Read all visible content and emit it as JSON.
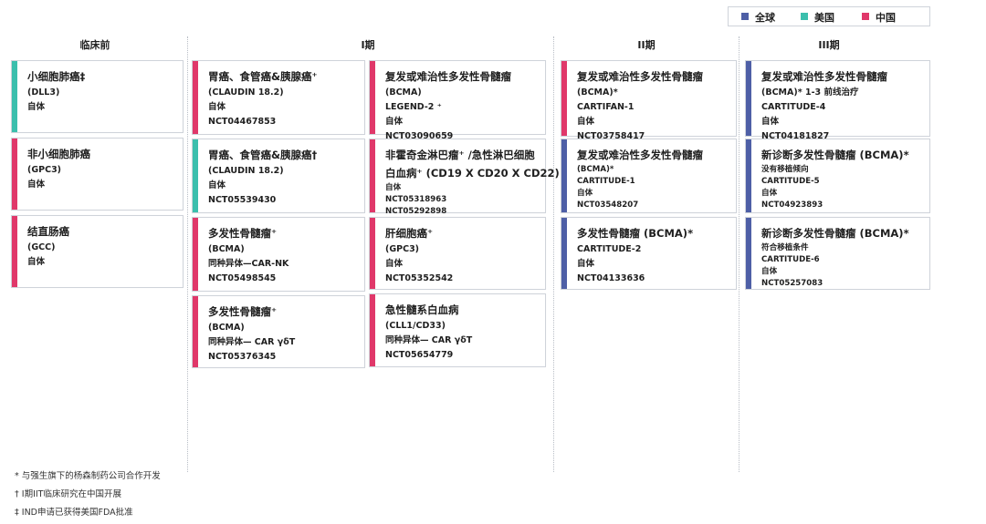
{
  "legend": [
    {
      "label": "全球",
      "color": "#4e5fa6"
    },
    {
      "label": "美国",
      "color": "#3bbfad"
    },
    {
      "label": "中国",
      "color": "#e0386a"
    }
  ],
  "phases": [
    "临床前",
    "I期",
    "II期",
    "III期"
  ],
  "cards": [
    {
      "id": "sclc",
      "color": "#3bbfad",
      "lines": [
        {
          "t": "小细胞肺癌‡",
          "k": "t"
        },
        {
          "t": "(DLL3)"
        },
        {
          "t": "自体"
        }
      ]
    },
    {
      "id": "nsclc",
      "color": "#e0386a",
      "lines": [
        {
          "t": "非小细胞肺癌",
          "k": "t"
        },
        {
          "t": "(GPC3)"
        },
        {
          "t": "自体"
        }
      ]
    },
    {
      "id": "crc",
      "color": "#e0386a",
      "lines": [
        {
          "t": "结直肠癌",
          "k": "t"
        },
        {
          "t": "(GCC)"
        },
        {
          "t": "自体"
        }
      ]
    },
    {
      "id": "gc1",
      "color": "#e0386a",
      "lines": [
        {
          "t": "胃癌、食管癌&胰腺癌⁺",
          "k": "t"
        },
        {
          "t": "(CLAUDIN 18.2)"
        },
        {
          "t": "自体"
        },
        {
          "t": "NCT04467853"
        }
      ]
    },
    {
      "id": "gc2",
      "color": "#3bbfad",
      "lines": [
        {
          "t": "胃癌、食管癌&胰腺癌†",
          "k": "t"
        },
        {
          "t": "(CLAUDIN 18.2)"
        },
        {
          "t": "自体"
        },
        {
          "t": "NCT05539430"
        }
      ]
    },
    {
      "id": "mm1",
      "color": "#e0386a",
      "lines": [
        {
          "t": "多发性骨髓瘤⁺",
          "k": "t"
        },
        {
          "t": "(BCMA)"
        },
        {
          "t": "同种异体—CAR-NK"
        },
        {
          "t": "NCT05498545"
        }
      ]
    },
    {
      "id": "mm2",
      "color": "#e0386a",
      "lines": [
        {
          "t": "多发性骨髓瘤⁺",
          "k": "t"
        },
        {
          "t": "(BCMA)"
        },
        {
          "t": "同种异体— CAR γδT"
        },
        {
          "t": "NCT05376345"
        }
      ]
    },
    {
      "id": "rrmm1",
      "color": "#e0386a",
      "lines": [
        {
          "t": "复发或难治性多发性骨髓瘤",
          "k": "t"
        },
        {
          "t": "(BCMA)"
        },
        {
          "t": "LEGEND-2 ⁺"
        },
        {
          "t": "自体"
        },
        {
          "t": "NCT03090659"
        }
      ]
    },
    {
      "id": "nhl",
      "color": "#e0386a",
      "lines": [
        {
          "t": "非霍奇金淋巴瘤⁺ /急性淋巴细胞",
          "k": "t"
        },
        {
          "t": "白血病⁺ (CD19 X CD20 X CD22) ⁺",
          "k": "t"
        },
        {
          "t": "自体",
          "k": "s"
        },
        {
          "t": "NCT05318963",
          "k": "s"
        },
        {
          "t": "NCT05292898",
          "k": "s"
        }
      ]
    },
    {
      "id": "hcc",
      "color": "#e0386a",
      "lines": [
        {
          "t": "肝细胞癌⁺",
          "k": "t"
        },
        {
          "t": "(GPC3)"
        },
        {
          "t": "自体"
        },
        {
          "t": "NCT05352542"
        }
      ]
    },
    {
      "id": "aml",
      "color": "#e0386a",
      "lines": [
        {
          "t": "急性髓系白血病",
          "k": "t"
        },
        {
          "t": "(CLL1/CD33)"
        },
        {
          "t": "同种异体— CAR γδT"
        },
        {
          "t": "NCT05654779"
        }
      ]
    },
    {
      "id": "p2a",
      "color": "#e0386a",
      "lines": [
        {
          "t": "复发或难治性多发性骨髓瘤",
          "k": "t"
        },
        {
          "t": "(BCMA)*"
        },
        {
          "t": "CARTIFAN-1"
        },
        {
          "t": "自体"
        },
        {
          "t": "NCT03758417"
        }
      ]
    },
    {
      "id": "p2b",
      "color": "#4e5fa6",
      "lines": [
        {
          "t": "复发或难治性多发性骨髓瘤",
          "k": "t"
        },
        {
          "t": "(BCMA)*",
          "k": "s"
        },
        {
          "t": "CARTITUDE-1",
          "k": "s"
        },
        {
          "t": "自体",
          "k": "s"
        },
        {
          "t": "NCT03548207",
          "k": "s"
        }
      ]
    },
    {
      "id": "p2c",
      "color": "#4e5fa6",
      "lines": [
        {
          "t": "多发性骨髓瘤 (BCMA)*",
          "k": "t"
        },
        {
          "t": "CARTITUDE-2"
        },
        {
          "t": "自体"
        },
        {
          "t": "NCT04133636"
        }
      ]
    },
    {
      "id": "p3a",
      "color": "#4e5fa6",
      "lines": [
        {
          "t": "复发或难治性多发性骨髓瘤",
          "k": "t"
        },
        {
          "t": "(BCMA)*   1-3 前线治疗"
        },
        {
          "t": "CARTITUDE-4"
        },
        {
          "t": "自体"
        },
        {
          "t": "NCT04181827"
        }
      ]
    },
    {
      "id": "p3b",
      "color": "#4e5fa6",
      "lines": [
        {
          "t": "新诊断多发性骨髓瘤 (BCMA)*",
          "k": "t"
        },
        {
          "t": "没有移植倾向",
          "k": "s"
        },
        {
          "t": "CARTITUDE-5",
          "k": "s"
        },
        {
          "t": "自体",
          "k": "s"
        },
        {
          "t": "NCT04923893",
          "k": "s"
        }
      ]
    },
    {
      "id": "p3c",
      "color": "#4e5fa6",
      "lines": [
        {
          "t": "新诊断多发性骨髓瘤 (BCMA)*",
          "k": "t"
        },
        {
          "t": "符合移植条件",
          "k": "s"
        },
        {
          "t": "CARTITUDE-6",
          "k": "s"
        },
        {
          "t": "自体",
          "k": "s"
        },
        {
          "t": "NCT05257083",
          "k": "s"
        }
      ]
    }
  ],
  "footnotes": [
    "* 与强生旗下的杨森制药公司合作开发",
    "† I期IIT临床研究在中国开展",
    "‡ IND申请已获得美国FDA批准"
  ]
}
